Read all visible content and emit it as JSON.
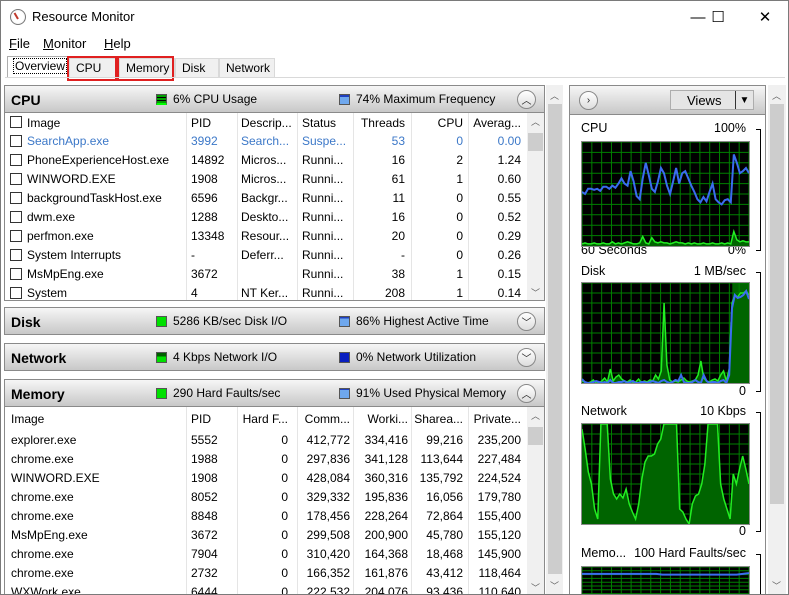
{
  "window": {
    "title": "Resource Monitor",
    "controls": {
      "minimize": "—",
      "maximize": "☐",
      "close": "✕"
    }
  },
  "menu": [
    {
      "label": "File",
      "accel": "F",
      "rest": "ile"
    },
    {
      "label": "Monitor",
      "accel": "M",
      "rest": "onitor"
    },
    {
      "label": "Help",
      "accel": "H",
      "rest": "elp"
    }
  ],
  "tabs": [
    {
      "label": "Overview",
      "active": true,
      "highlighted": false
    },
    {
      "label": "CPU",
      "active": false,
      "highlighted": true
    },
    {
      "label": "Memory",
      "active": false,
      "highlighted": true
    },
    {
      "label": "Disk",
      "active": false,
      "highlighted": false
    },
    {
      "label": "Network",
      "active": false,
      "highlighted": false
    }
  ],
  "highlight_color": "#e02020",
  "cpu": {
    "title": "CPU",
    "indicator1": "6% CPU Usage",
    "indicator2": "74% Maximum Frequency",
    "expanded": true,
    "columns": [
      "Image",
      "PID",
      "Descrip...",
      "Status",
      "Threads",
      "CPU",
      "Averag..."
    ],
    "rows": [
      {
        "image": "SearchApp.exe",
        "pid": "3992",
        "desc": "Search...",
        "status": "Suspe...",
        "threads": "53",
        "cpu": "0",
        "avg": "0.00",
        "suspended": true
      },
      {
        "image": "PhoneExperienceHost.exe",
        "pid": "14892",
        "desc": "Micros...",
        "status": "Runni...",
        "threads": "16",
        "cpu": "2",
        "avg": "1.24"
      },
      {
        "image": "WINWORD.EXE",
        "pid": "1908",
        "desc": "Micros...",
        "status": "Runni...",
        "threads": "61",
        "cpu": "1",
        "avg": "0.60"
      },
      {
        "image": "backgroundTaskHost.exe",
        "pid": "6596",
        "desc": "Backgr...",
        "status": "Runni...",
        "threads": "11",
        "cpu": "0",
        "avg": "0.55"
      },
      {
        "image": "dwm.exe",
        "pid": "1288",
        "desc": "Deskto...",
        "status": "Runni...",
        "threads": "16",
        "cpu": "0",
        "avg": "0.52"
      },
      {
        "image": "perfmon.exe",
        "pid": "13348",
        "desc": "Resour...",
        "status": "Runni...",
        "threads": "20",
        "cpu": "0",
        "avg": "0.29"
      },
      {
        "image": "System Interrupts",
        "pid": "-",
        "desc": "Deferr...",
        "status": "Runni...",
        "threads": "-",
        "cpu": "0",
        "avg": "0.26"
      },
      {
        "image": "MsMpEng.exe",
        "pid": "3672",
        "desc": "",
        "status": "Runni...",
        "threads": "38",
        "cpu": "1",
        "avg": "0.15"
      },
      {
        "image": "System",
        "pid": "4",
        "desc": "NT Ker...",
        "status": "Runni...",
        "threads": "208",
        "cpu": "1",
        "avg": "0.14"
      }
    ]
  },
  "disk": {
    "title": "Disk",
    "indicator1": "5286 KB/sec Disk I/O",
    "indicator2": "86% Highest Active Time",
    "expanded": false
  },
  "network": {
    "title": "Network",
    "indicator1": "4 Kbps Network I/O",
    "indicator2": "0% Network Utilization",
    "expanded": false
  },
  "memory": {
    "title": "Memory",
    "indicator1": "290 Hard Faults/sec",
    "indicator2": "91% Used Physical Memory",
    "expanded": true,
    "columns": [
      "Image",
      "PID",
      "Hard F...",
      "Comm...",
      "Worki...",
      "Sharea...",
      "Private..."
    ],
    "rows": [
      [
        "explorer.exe",
        "5552",
        "0",
        "412,772",
        "334,416",
        "99,216",
        "235,200"
      ],
      [
        "chrome.exe",
        "1988",
        "0",
        "297,836",
        "341,128",
        "113,644",
        "227,484"
      ],
      [
        "WINWORD.EXE",
        "1908",
        "0",
        "428,084",
        "360,316",
        "135,792",
        "224,524"
      ],
      [
        "chrome.exe",
        "8052",
        "0",
        "329,332",
        "195,836",
        "16,056",
        "179,780"
      ],
      [
        "chrome.exe",
        "8848",
        "0",
        "178,456",
        "228,264",
        "72,864",
        "155,400"
      ],
      [
        "MsMpEng.exe",
        "3672",
        "0",
        "299,508",
        "200,900",
        "45,780",
        "155,120"
      ],
      [
        "chrome.exe",
        "7904",
        "0",
        "310,420",
        "164,368",
        "18,468",
        "145,900"
      ],
      [
        "chrome.exe",
        "2732",
        "0",
        "166,352",
        "161,876",
        "43,412",
        "118,464"
      ],
      [
        "WXWork.exe",
        "6444",
        "0",
        "222,532",
        "204,076",
        "93,436",
        "110,640"
      ]
    ]
  },
  "side": {
    "views_label": "Views",
    "graphs": [
      {
        "name": "CPU",
        "max": "100%",
        "min": "0%",
        "footer": "60 Seconds",
        "blue": [
          52,
          50,
          55,
          55,
          54,
          55,
          53,
          57,
          57,
          55,
          58,
          56,
          60,
          65,
          60,
          58,
          72,
          62,
          48,
          45,
          65,
          80,
          68,
          55,
          52,
          62,
          75,
          70,
          58,
          50,
          62,
          75,
          60,
          70,
          72,
          65,
          58,
          52,
          45,
          42,
          47,
          43,
          52,
          60,
          45,
          42,
          40,
          44,
          45,
          42,
          88,
          80,
          70,
          72,
          75,
          70
        ],
        "green": [
          2,
          3,
          2,
          2,
          3,
          2,
          2,
          3,
          2,
          2,
          4,
          2,
          3,
          2,
          3,
          4,
          3,
          2,
          2,
          3,
          9,
          3,
          2,
          8,
          4,
          3,
          4,
          3,
          3,
          2,
          3,
          4,
          3,
          3,
          2,
          3,
          2,
          3,
          2,
          2,
          3,
          2,
          2,
          3,
          2,
          2,
          3,
          2,
          3,
          2,
          14,
          6,
          4,
          5,
          4,
          4
        ]
      },
      {
        "name": "Disk",
        "max": "1 MB/sec",
        "min": "0",
        "blue": [
          4,
          1,
          0,
          0,
          1,
          2,
          1,
          0,
          1,
          0,
          3,
          0,
          0,
          1,
          1,
          2,
          0,
          1,
          2,
          0,
          0,
          1,
          1,
          0,
          1,
          2,
          1,
          0,
          2,
          3,
          1,
          0,
          1,
          3,
          2,
          8,
          1,
          0,
          0,
          1,
          3,
          1,
          0,
          8,
          2,
          0,
          1,
          1,
          0,
          2,
          3,
          0,
          8,
          75,
          88,
          85,
          86,
          88,
          92,
          84
        ],
        "green": [
          2,
          1,
          0,
          1,
          3,
          0,
          0,
          2,
          5,
          1,
          14,
          2,
          6,
          8,
          4,
          2,
          1,
          3,
          0,
          1,
          4,
          0,
          2,
          1,
          3,
          2,
          8,
          4,
          12,
          80,
          18,
          3,
          1,
          2,
          1,
          3,
          5,
          2,
          1,
          2,
          3,
          8,
          22,
          5,
          2,
          1,
          3,
          4,
          2,
          8,
          12,
          2,
          14,
          80,
          88,
          86,
          90,
          90,
          92,
          88
        ],
        "active_from": 0.9
      },
      {
        "name": "Network",
        "max": "10 Kbps",
        "min": "0",
        "green": [
          95,
          75,
          52,
          40,
          15,
          5,
          100,
          100,
          100,
          45,
          30,
          25,
          30,
          26,
          35,
          20,
          12,
          5,
          20,
          45,
          62,
          68,
          68,
          70,
          80,
          85,
          100,
          100,
          100,
          100,
          100,
          15,
          12,
          5,
          0,
          20,
          28,
          30,
          40,
          60,
          100,
          100,
          100,
          100,
          40,
          25,
          15,
          5,
          50,
          40,
          55,
          68,
          55,
          40
        ]
      },
      {
        "name": "Memo...",
        "max": "100 Hard Faults/sec",
        "min": "",
        "blue": [
          82,
          82,
          82,
          82,
          82,
          82,
          82,
          82,
          82,
          82,
          82,
          82,
          82,
          80,
          80,
          80,
          80,
          80,
          80,
          80,
          80,
          80,
          80,
          80,
          80,
          80,
          82,
          84
        ]
      }
    ]
  }
}
